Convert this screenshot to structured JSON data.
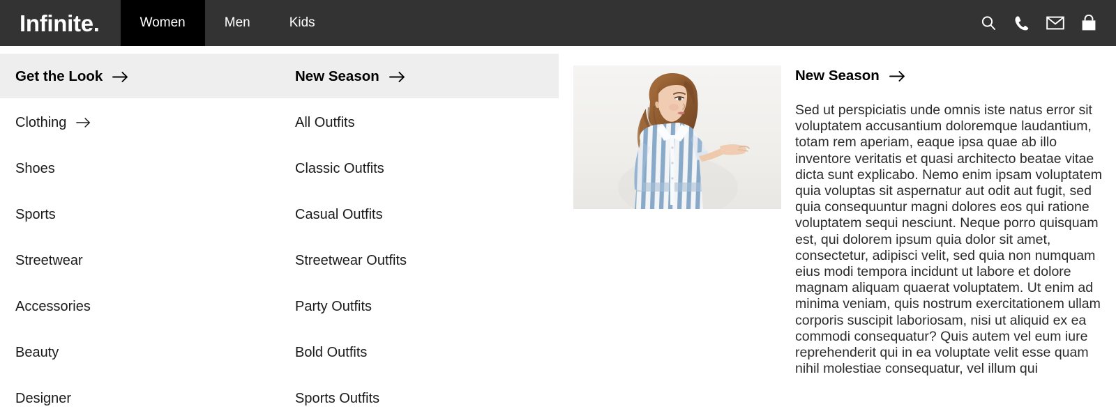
{
  "header": {
    "brand": "Infinite.",
    "nav": [
      {
        "label": "Women",
        "active": true
      },
      {
        "label": "Men",
        "active": false
      },
      {
        "label": "Kids",
        "active": false
      }
    ],
    "icons": [
      {
        "name": "search-icon"
      },
      {
        "name": "phone-icon"
      },
      {
        "name": "envelope-icon"
      },
      {
        "name": "shopping-bag-icon"
      }
    ]
  },
  "megamenu": {
    "left_column": {
      "heading": "Get the Look",
      "heading_has_arrow": true,
      "items": [
        {
          "label": "Clothing",
          "has_arrow": true
        },
        {
          "label": "Shoes",
          "has_arrow": false
        },
        {
          "label": "Sports",
          "has_arrow": false
        },
        {
          "label": "Streetwear",
          "has_arrow": false
        },
        {
          "label": "Accessories",
          "has_arrow": false
        },
        {
          "label": "Beauty",
          "has_arrow": false
        },
        {
          "label": "Designer",
          "has_arrow": false
        }
      ]
    },
    "mid_column": {
      "heading": "New Season",
      "heading_has_arrow": true,
      "items": [
        {
          "label": "All Outfits",
          "has_arrow": false
        },
        {
          "label": "Classic Outfits",
          "has_arrow": false
        },
        {
          "label": "Casual Outfits",
          "has_arrow": false
        },
        {
          "label": "Streetwear Outfits",
          "has_arrow": false
        },
        {
          "label": "Party Outfits",
          "has_arrow": false
        },
        {
          "label": "Bold Outfits",
          "has_arrow": false
        },
        {
          "label": "Sports Outfits",
          "has_arrow": false
        }
      ]
    },
    "promo": {
      "image_alt": "woman in blue and white striped shirt dress presenting with open hand",
      "heading": "New Season",
      "heading_has_arrow": true,
      "body": "Sed ut perspiciatis unde omnis iste natus error sit voluptatem accusantium doloremque laudantium, totam rem aperiam, eaque ipsa quae ab illo inventore veritatis et quasi architecto beatae vitae dicta sunt explicabo. Nemo enim ipsam voluptatem quia voluptas sit aspernatur aut odit aut fugit, sed quia consequuntur magni dolores eos qui ratione voluptatem sequi nesciunt. Neque porro quisquam est, qui dolorem ipsum quia dolor sit amet, consectetur, adipisci velit, sed quia non numquam eius modi tempora incidunt ut labore et dolore magnam aliquam quaerat voluptatem. Ut enim ad minima veniam, quis nostrum exercitationem ullam corporis suscipit laboriosam, nisi ut aliquid ex ea commodi consequatur? Quis autem vel eum iure reprehenderit qui in ea voluptate velit esse quam nihil molestiae consequatur, vel illum qui"
    }
  },
  "colors": {
    "header_bg": "#333333",
    "active_tab_bg": "#000000",
    "panel_bg": "#ffffff",
    "highlight_band": "#eeeeee",
    "text": "#1a1a1a"
  }
}
